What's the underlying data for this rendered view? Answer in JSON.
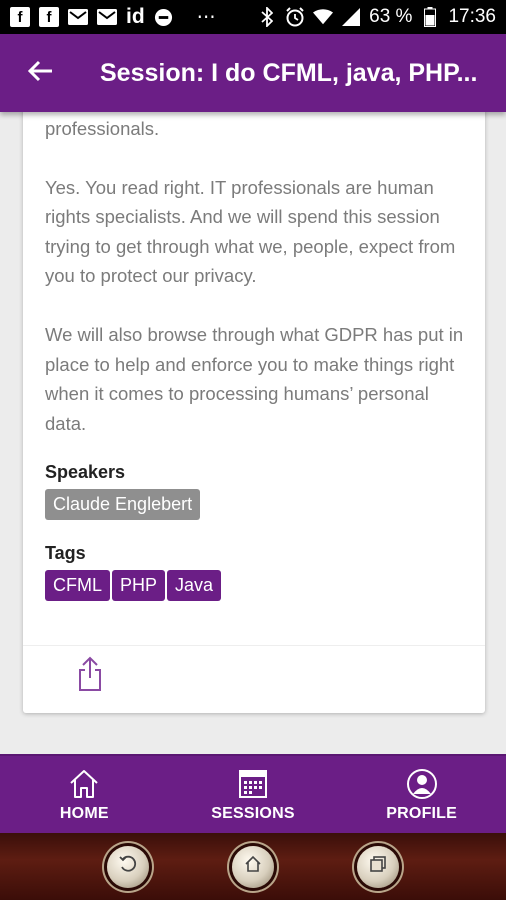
{
  "status_bar": {
    "icons": [
      "facebook-icon",
      "facebook-icon",
      "gmail-icon",
      "gmail-icon",
      "id-icon",
      "do-not-disturb-icon",
      "more-icon",
      "bluetooth-icon",
      "alarm-icon",
      "wifi-icon",
      "signal-icon",
      "battery-icon"
    ],
    "id_text": "id",
    "more_text": "⋯",
    "battery": "63 %",
    "time": "17:36"
  },
  "app_bar": {
    "title": "Session: I do CFML, java, PHP...",
    "back_icon": "arrow-back-icon"
  },
  "session": {
    "description": [
      "managers are underestimated human rights professionals.",
      "Yes. You read right. IT professionals are human rights specialists. And we will spend this session trying to get through what we, people, expect from you to protect our privacy.",
      "We will also browse through what GDPR has put in place to help and enforce you to make things right when it comes to processing humans’ personal data."
    ],
    "speakers_label": "Speakers",
    "speakers": [
      "Claude Englebert"
    ],
    "tags_label": "Tags",
    "tags": [
      "CFML",
      "PHP",
      "Java"
    ],
    "share_icon": "share-icon"
  },
  "bottom_nav": {
    "items": [
      {
        "label": "HOME",
        "icon": "home-icon"
      },
      {
        "label": "SESSIONS",
        "icon": "calendar-icon"
      },
      {
        "label": "PROFILE",
        "icon": "profile-icon"
      }
    ]
  },
  "colors": {
    "primary": "#6b1e86",
    "speaker_chip": "#8f8f8f",
    "text_muted": "#7b7b7b"
  }
}
